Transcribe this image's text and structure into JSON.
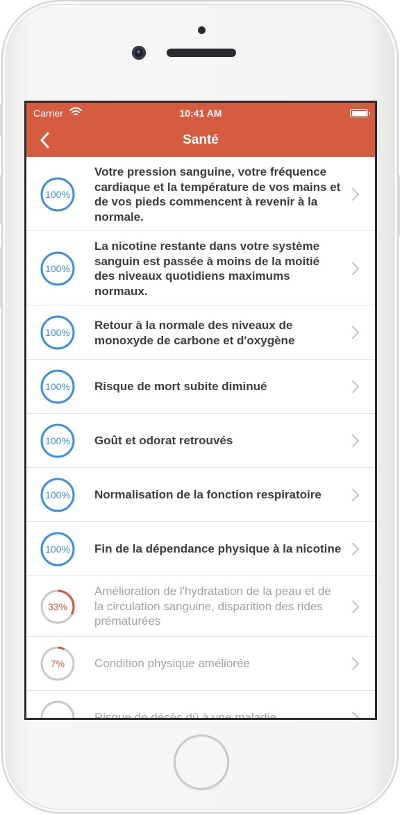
{
  "status": {
    "carrier": "Carrier",
    "time": "10:41 AM"
  },
  "nav": {
    "title": "Santé"
  },
  "colors": {
    "accent": "#d65c40",
    "complete": "#3d8ee0",
    "partial": "#dd5536",
    "track": "#c9c9c9"
  },
  "items": [
    {
      "label": "Votre pression sanguine, votre fréquence cardiaque et la température de vos mains et de vos pieds commencent à revenir à la normale.",
      "progress": 100,
      "percent_text": "100%"
    },
    {
      "label": "La nicotine restante dans votre système sanguin est passée à moins de la moitié des niveaux quotidiens maximums normaux.",
      "progress": 100,
      "percent_text": "100%"
    },
    {
      "label": "Retour à la normale des niveaux de monoxyde de carbone et d'oxygène",
      "progress": 100,
      "percent_text": "100%"
    },
    {
      "label": "Risque de mort subite diminué",
      "progress": 100,
      "percent_text": "100%"
    },
    {
      "label": "Goût et odorat retrouvés",
      "progress": 100,
      "percent_text": "100%"
    },
    {
      "label": "Normalisation de la fonction respiratoire",
      "progress": 100,
      "percent_text": "100%"
    },
    {
      "label": "Fin de la dépendance physique à la nicotine",
      "progress": 100,
      "percent_text": "100%"
    },
    {
      "label": "Amélioration de l'hydratation de la peau et de la circulation sanguine, disparition des rides prématurées",
      "progress": 33,
      "percent_text": "33%"
    },
    {
      "label": "Condition physique améliorée",
      "progress": 7,
      "percent_text": "7%"
    },
    {
      "label": "Risque de décès dû à une maladie",
      "progress": 0,
      "percent_text": ""
    }
  ]
}
